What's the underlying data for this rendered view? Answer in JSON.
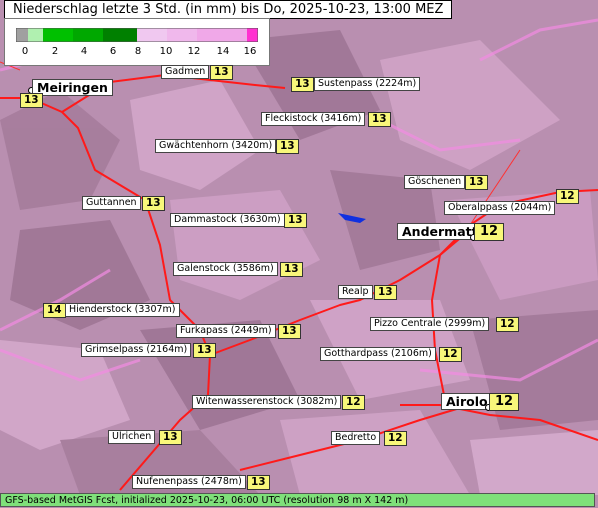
{
  "title": "Niederschlag letzte 3 Std. (in mm) bis Do, 2025-10-23, 13:00 MEZ",
  "legend": {
    "ticks": [
      "0",
      "2",
      "4",
      "6",
      "8",
      "10",
      "12",
      "14",
      "16"
    ],
    "colors": [
      "#a0a0a0",
      "#b0f0b0",
      "#00c000",
      "#00a800",
      "#008000",
      "#f0c8f0",
      "#f0b8ec",
      "#f0a8e8",
      "#ff30d0"
    ]
  },
  "places": [
    {
      "name": "Meiringen",
      "value": "13",
      "big": true
    },
    {
      "name": "Gadmen",
      "value": "13"
    },
    {
      "name": "Sustenpass (2224m)",
      "value": "13"
    },
    {
      "name": "Fleckistock (3416m)",
      "value": "13"
    },
    {
      "name": "Gwächtenhorn (3420m)",
      "value": "13"
    },
    {
      "name": "Göschenen",
      "value": "13"
    },
    {
      "name": "Oberalppass (2044m)",
      "value": "12"
    },
    {
      "name": "Guttannen",
      "value": "13"
    },
    {
      "name": "Dammastock (3630m)",
      "value": "13"
    },
    {
      "name": "Andermatt",
      "value": "12",
      "big": true
    },
    {
      "name": "Galenstock (3586m)",
      "value": "13"
    },
    {
      "name": "Realp",
      "value": "13"
    },
    {
      "name": "Hienderstock (3307m)",
      "value": "14"
    },
    {
      "name": "Furkapass (2449m)",
      "value": "13"
    },
    {
      "name": "Pizzo Centrale (2999m)",
      "value": "12"
    },
    {
      "name": "Grimselpass (2164m)",
      "value": "13"
    },
    {
      "name": "Gotthardpass (2106m)",
      "value": "12"
    },
    {
      "name": "Airolo",
      "value": "12",
      "big": true
    },
    {
      "name": "Witenwasserenstock (3082m)",
      "value": "12"
    },
    {
      "name": "Ulrichen",
      "value": "13"
    },
    {
      "name": "Bedretto",
      "value": "12"
    },
    {
      "name": "Nufenenpass (2478m)",
      "value": "13"
    }
  ],
  "footer": "GFS-based MetGIS Fcst, initialized 2025-10-23, 06:00 UTC  (resolution 98 m X 142 m)"
}
